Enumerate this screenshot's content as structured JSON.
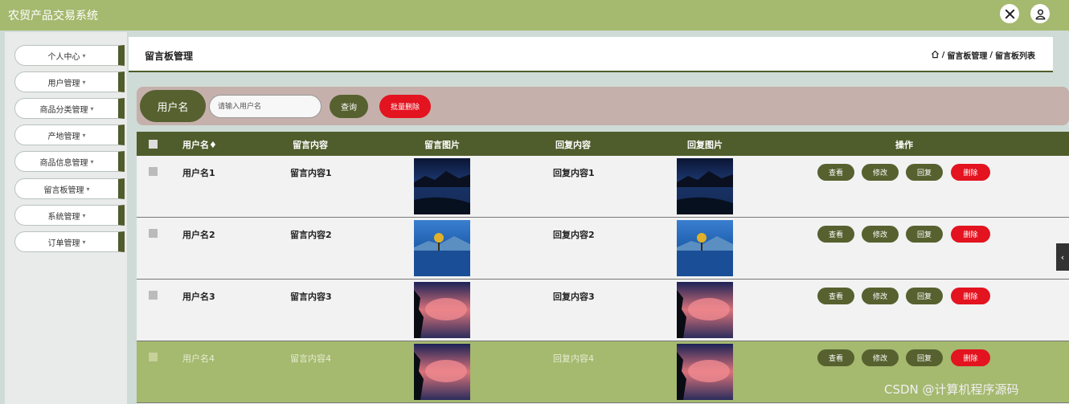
{
  "app": {
    "title": "农贸产品交易系统"
  },
  "header_icons": [
    "close-x-icon",
    "user-icon"
  ],
  "sidebar": {
    "items": [
      {
        "label": "个人中心"
      },
      {
        "label": "用户管理"
      },
      {
        "label": "商品分类管理"
      },
      {
        "label": "产地管理"
      },
      {
        "label": "商品信息管理"
      },
      {
        "label": "留言板管理"
      },
      {
        "label": "系统管理"
      },
      {
        "label": "订单管理"
      }
    ],
    "caret": "▾"
  },
  "page": {
    "title": "留言板管理",
    "breadcrumb": [
      "留言板管理",
      "留言板列表"
    ],
    "breadcrumb_sep": "/"
  },
  "search": {
    "label": "用户名",
    "placeholder": "请输入用户名",
    "query_label": "查询",
    "batch_delete_label": "批量删除"
  },
  "table": {
    "headers": {
      "username": "用户名♦",
      "content": "留言内容",
      "image": "留言图片",
      "reply": "回复内容",
      "reply_image": "回复图片",
      "actions": "操作"
    },
    "rows": [
      {
        "username": "用户名1",
        "content": "留言内容1",
        "reply": "回复内容1",
        "image": "night-lake-photo"
      },
      {
        "username": "用户名2",
        "content": "留言内容2",
        "reply": "回复内容2",
        "image": "blue-lake-tree-photo"
      },
      {
        "username": "用户名3",
        "content": "留言内容3",
        "reply": "回复内容3",
        "image": "pink-cloud-photo"
      },
      {
        "username": "用户名4",
        "content": "留言内容4",
        "reply": "回复内容4",
        "image": "pink-cloud-photo"
      }
    ],
    "actions": {
      "view": "查看",
      "edit": "修改",
      "reply": "回复",
      "delete": "删除"
    }
  },
  "colors": {
    "accent": "#4f5c2b",
    "topbar": "#a5b96f",
    "danger": "#e3131f",
    "search_bg": "#c5b0ab"
  },
  "side_toggle": "‹",
  "watermark": "CSDN @计算机程序源码"
}
